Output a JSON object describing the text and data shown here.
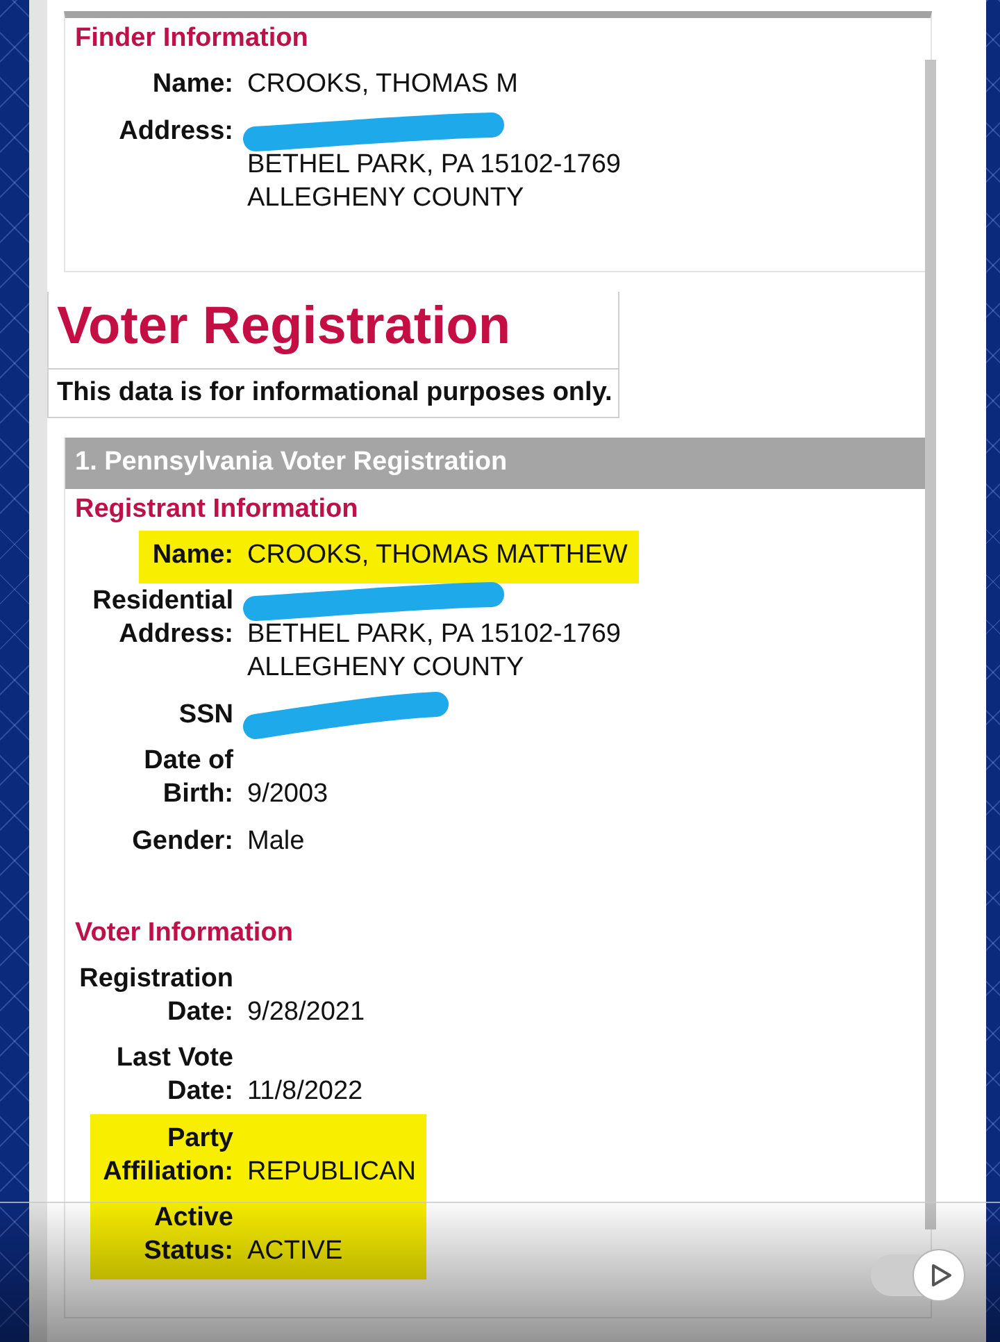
{
  "finder": {
    "heading": "Finder Information",
    "fields": [
      {
        "label": "Name:",
        "highlighted": false,
        "lines": [
          {
            "text": "CROOKS, THOMAS M",
            "redacted": false
          }
        ]
      },
      {
        "label": "Address:",
        "highlighted": false,
        "lines": [
          {
            "redacted": true
          },
          {
            "text": "BETHEL PARK, PA 15102-1769",
            "redacted": false
          },
          {
            "text": "ALLEGHENY COUNTY",
            "redacted": false
          }
        ]
      }
    ]
  },
  "report": {
    "title": "Voter Registration",
    "notice": "This data is for informational purposes only."
  },
  "record": {
    "header": "1. Pennsylvania Voter Registration",
    "sections": [
      {
        "heading": "Registrant Information",
        "fields": [
          {
            "label": "Name:",
            "highlighted": true,
            "lines": [
              {
                "text": "CROOKS, THOMAS MATTHEW",
                "redacted": false
              }
            ]
          },
          {
            "label": "Residential Address:",
            "highlighted": false,
            "lines": [
              {
                "redacted": true
              },
              {
                "text": "BETHEL PARK, PA 15102-1769",
                "redacted": false
              },
              {
                "text": "ALLEGHENY COUNTY",
                "redacted": false
              }
            ]
          },
          {
            "label": "SSN",
            "highlighted": false,
            "lines": [
              {
                "redacted": true
              }
            ]
          },
          {
            "label": "Date of Birth:",
            "highlighted": false,
            "lines": [
              {
                "text": "9/2003",
                "redacted": false
              }
            ]
          },
          {
            "label": "Gender:",
            "highlighted": false,
            "lines": [
              {
                "text": "Male",
                "redacted": false
              }
            ]
          }
        ]
      },
      {
        "heading": "Voter Information",
        "fields": [
          {
            "label": "Registration Date:",
            "highlighted": false,
            "lines": [
              {
                "text": "9/28/2021",
                "redacted": false
              }
            ]
          },
          {
            "label": "Last Vote Date:",
            "highlighted": false,
            "lines": [
              {
                "text": "11/8/2022",
                "redacted": false
              }
            ]
          },
          {
            "label": "Party Affiliation:",
            "highlighted": true,
            "lines": [
              {
                "text": "REPUBLICAN",
                "redacted": false
              }
            ]
          },
          {
            "label": "Active Status:",
            "highlighted": true,
            "lines": [
              {
                "text": "ACTIVE",
                "redacted": false
              }
            ]
          }
        ]
      }
    ]
  },
  "player": {
    "autoplay_on": true
  }
}
